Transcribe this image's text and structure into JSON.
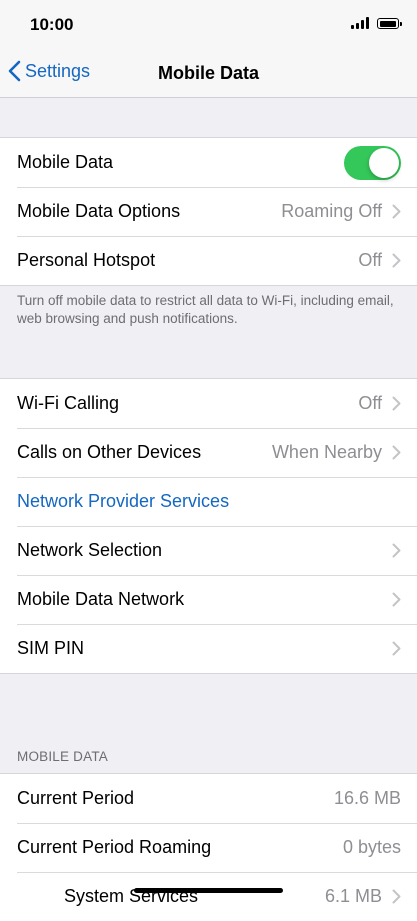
{
  "status_bar": {
    "time": "10:00"
  },
  "nav": {
    "back_label": "Settings",
    "title": "Mobile Data"
  },
  "group1": [
    {
      "label": "Mobile Data",
      "toggle_on": true
    },
    {
      "label": "Mobile Data Options",
      "value": "Roaming Off"
    },
    {
      "label": "Personal Hotspot",
      "value": "Off"
    }
  ],
  "group1_footer": "Turn off mobile data to restrict all data to Wi-Fi, including email, web browsing and push notifications.",
  "group2": [
    {
      "label": "Wi-Fi Calling",
      "value": "Off"
    },
    {
      "label": "Calls on Other Devices",
      "value": "When Nearby"
    },
    {
      "label": "Network Provider Services"
    },
    {
      "label": "Network Selection"
    },
    {
      "label": "Mobile Data Network"
    },
    {
      "label": "SIM PIN"
    }
  ],
  "section3_header": "MOBILE DATA",
  "group3": [
    {
      "label": "Current Period",
      "value": "16.6 MB"
    },
    {
      "label": "Current Period Roaming",
      "value": "0 bytes"
    },
    {
      "label": "System Services",
      "value": "6.1 MB"
    }
  ],
  "colors": {
    "accent": "#1467c2",
    "toggle_on": "#34c759",
    "secondary_text": "#8e8e93"
  }
}
